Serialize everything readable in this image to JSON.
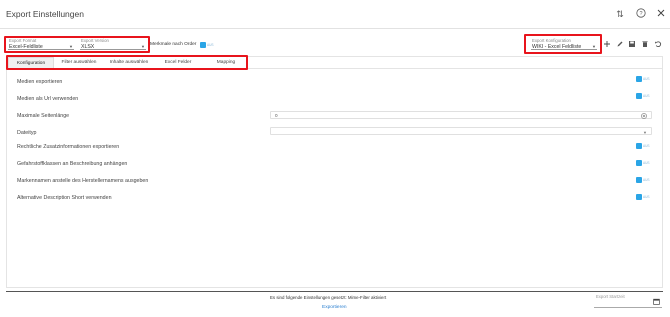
{
  "window": {
    "title": "Export Einstellungen",
    "icons": {
      "sort": "sort-icon",
      "help": "help-icon",
      "close": "close-icon"
    }
  },
  "top_fields": {
    "export_format": {
      "label": "Export Format",
      "value": "Excel-Feldliste"
    },
    "export_version": {
      "label": "Export Version",
      "value": "XLSX"
    },
    "merkmale": {
      "label": "Merkmale nach Order",
      "toggle": "AUS"
    },
    "export_config": {
      "label": "Export Konfiguration",
      "value": "WIKI - Excel Feldliste"
    }
  },
  "right_toolbar": {
    "icons": [
      "add-icon",
      "edit-icon",
      "save-icon",
      "delete-icon",
      "undo-icon"
    ]
  },
  "tabs": [
    {
      "label": "Konfiguration",
      "active": true
    },
    {
      "label": "Filter auswählen",
      "active": false
    },
    {
      "label": "Inhalte auswählen",
      "active": false
    },
    {
      "label": "Excel Felder",
      "active": false
    },
    {
      "label": "Mapping",
      "active": false
    }
  ],
  "settings": [
    {
      "label": "Medien exportieren",
      "type": "toggle",
      "value": "AUS"
    },
    {
      "label": "Medien als Url verwenden",
      "type": "toggle",
      "value": "AUS"
    },
    {
      "label": "Maximale Seitenlänge",
      "type": "number",
      "value": "0"
    },
    {
      "label": "Dateityp",
      "type": "select",
      "value": ""
    },
    {
      "label": "Rechtliche Zusatzinformationen exportieren",
      "type": "toggle",
      "value": "AUS"
    },
    {
      "label": "Gefahrstoffklassen an Beschreibung anhängen",
      "type": "toggle",
      "value": "AUS"
    },
    {
      "label": "Markennamen anstelle des Herstellernamens ausgeben",
      "type": "toggle",
      "value": "AUS"
    },
    {
      "label": "Alternative Description Short verwenden",
      "type": "toggle",
      "value": "AUS"
    }
  ],
  "footer": {
    "info": "Es sind folgende Einstellungen gesetzt: Mime-Filter aktiviert",
    "export_button": "Exportieren",
    "export_start_label": "Export Startzeit"
  },
  "colors": {
    "accent": "#2aa5e6",
    "highlight": "#e8141c",
    "link": "#2a7fd0"
  }
}
